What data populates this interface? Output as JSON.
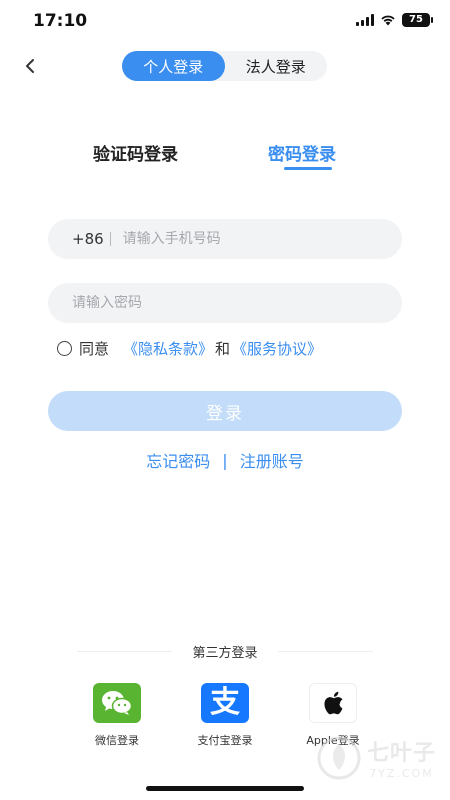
{
  "status_bar": {
    "time": "17:10",
    "battery": "75"
  },
  "header": {
    "back_icon": "chevron-left-icon",
    "mode_tabs": [
      {
        "label": "个人登录",
        "active": true
      },
      {
        "label": "法人登录",
        "active": false
      }
    ]
  },
  "login_tabs": [
    {
      "label": "验证码登录",
      "active": false
    },
    {
      "label": "密码登录",
      "active": true
    }
  ],
  "form": {
    "phone_prefix": "+86",
    "phone_placeholder": "请输入手机号码",
    "password_placeholder": "请输入密码",
    "agree_label": "同意",
    "privacy_link": "《隐私条款》",
    "and_text": "和",
    "service_link": "《服务协议》",
    "login_button": "登录",
    "forgot_password": "忘记密码",
    "separator": "|",
    "register": "注册账号"
  },
  "third_party": {
    "title": "第三方登录",
    "providers": [
      {
        "label": "微信登录",
        "icon": "wechat-icon"
      },
      {
        "label": "支付宝登录",
        "icon": "alipay-icon",
        "glyph": "支"
      },
      {
        "label": "Apple登录",
        "icon": "apple-icon"
      }
    ]
  },
  "watermark": {
    "cn": "七叶子",
    "en": "7YZ.COM"
  },
  "colors": {
    "accent": "#3a8ef0",
    "login_button_disabled": "#c2dcf9",
    "field_bg": "#f2f3f5",
    "wechat": "#58b431",
    "alipay": "#1677ff"
  }
}
